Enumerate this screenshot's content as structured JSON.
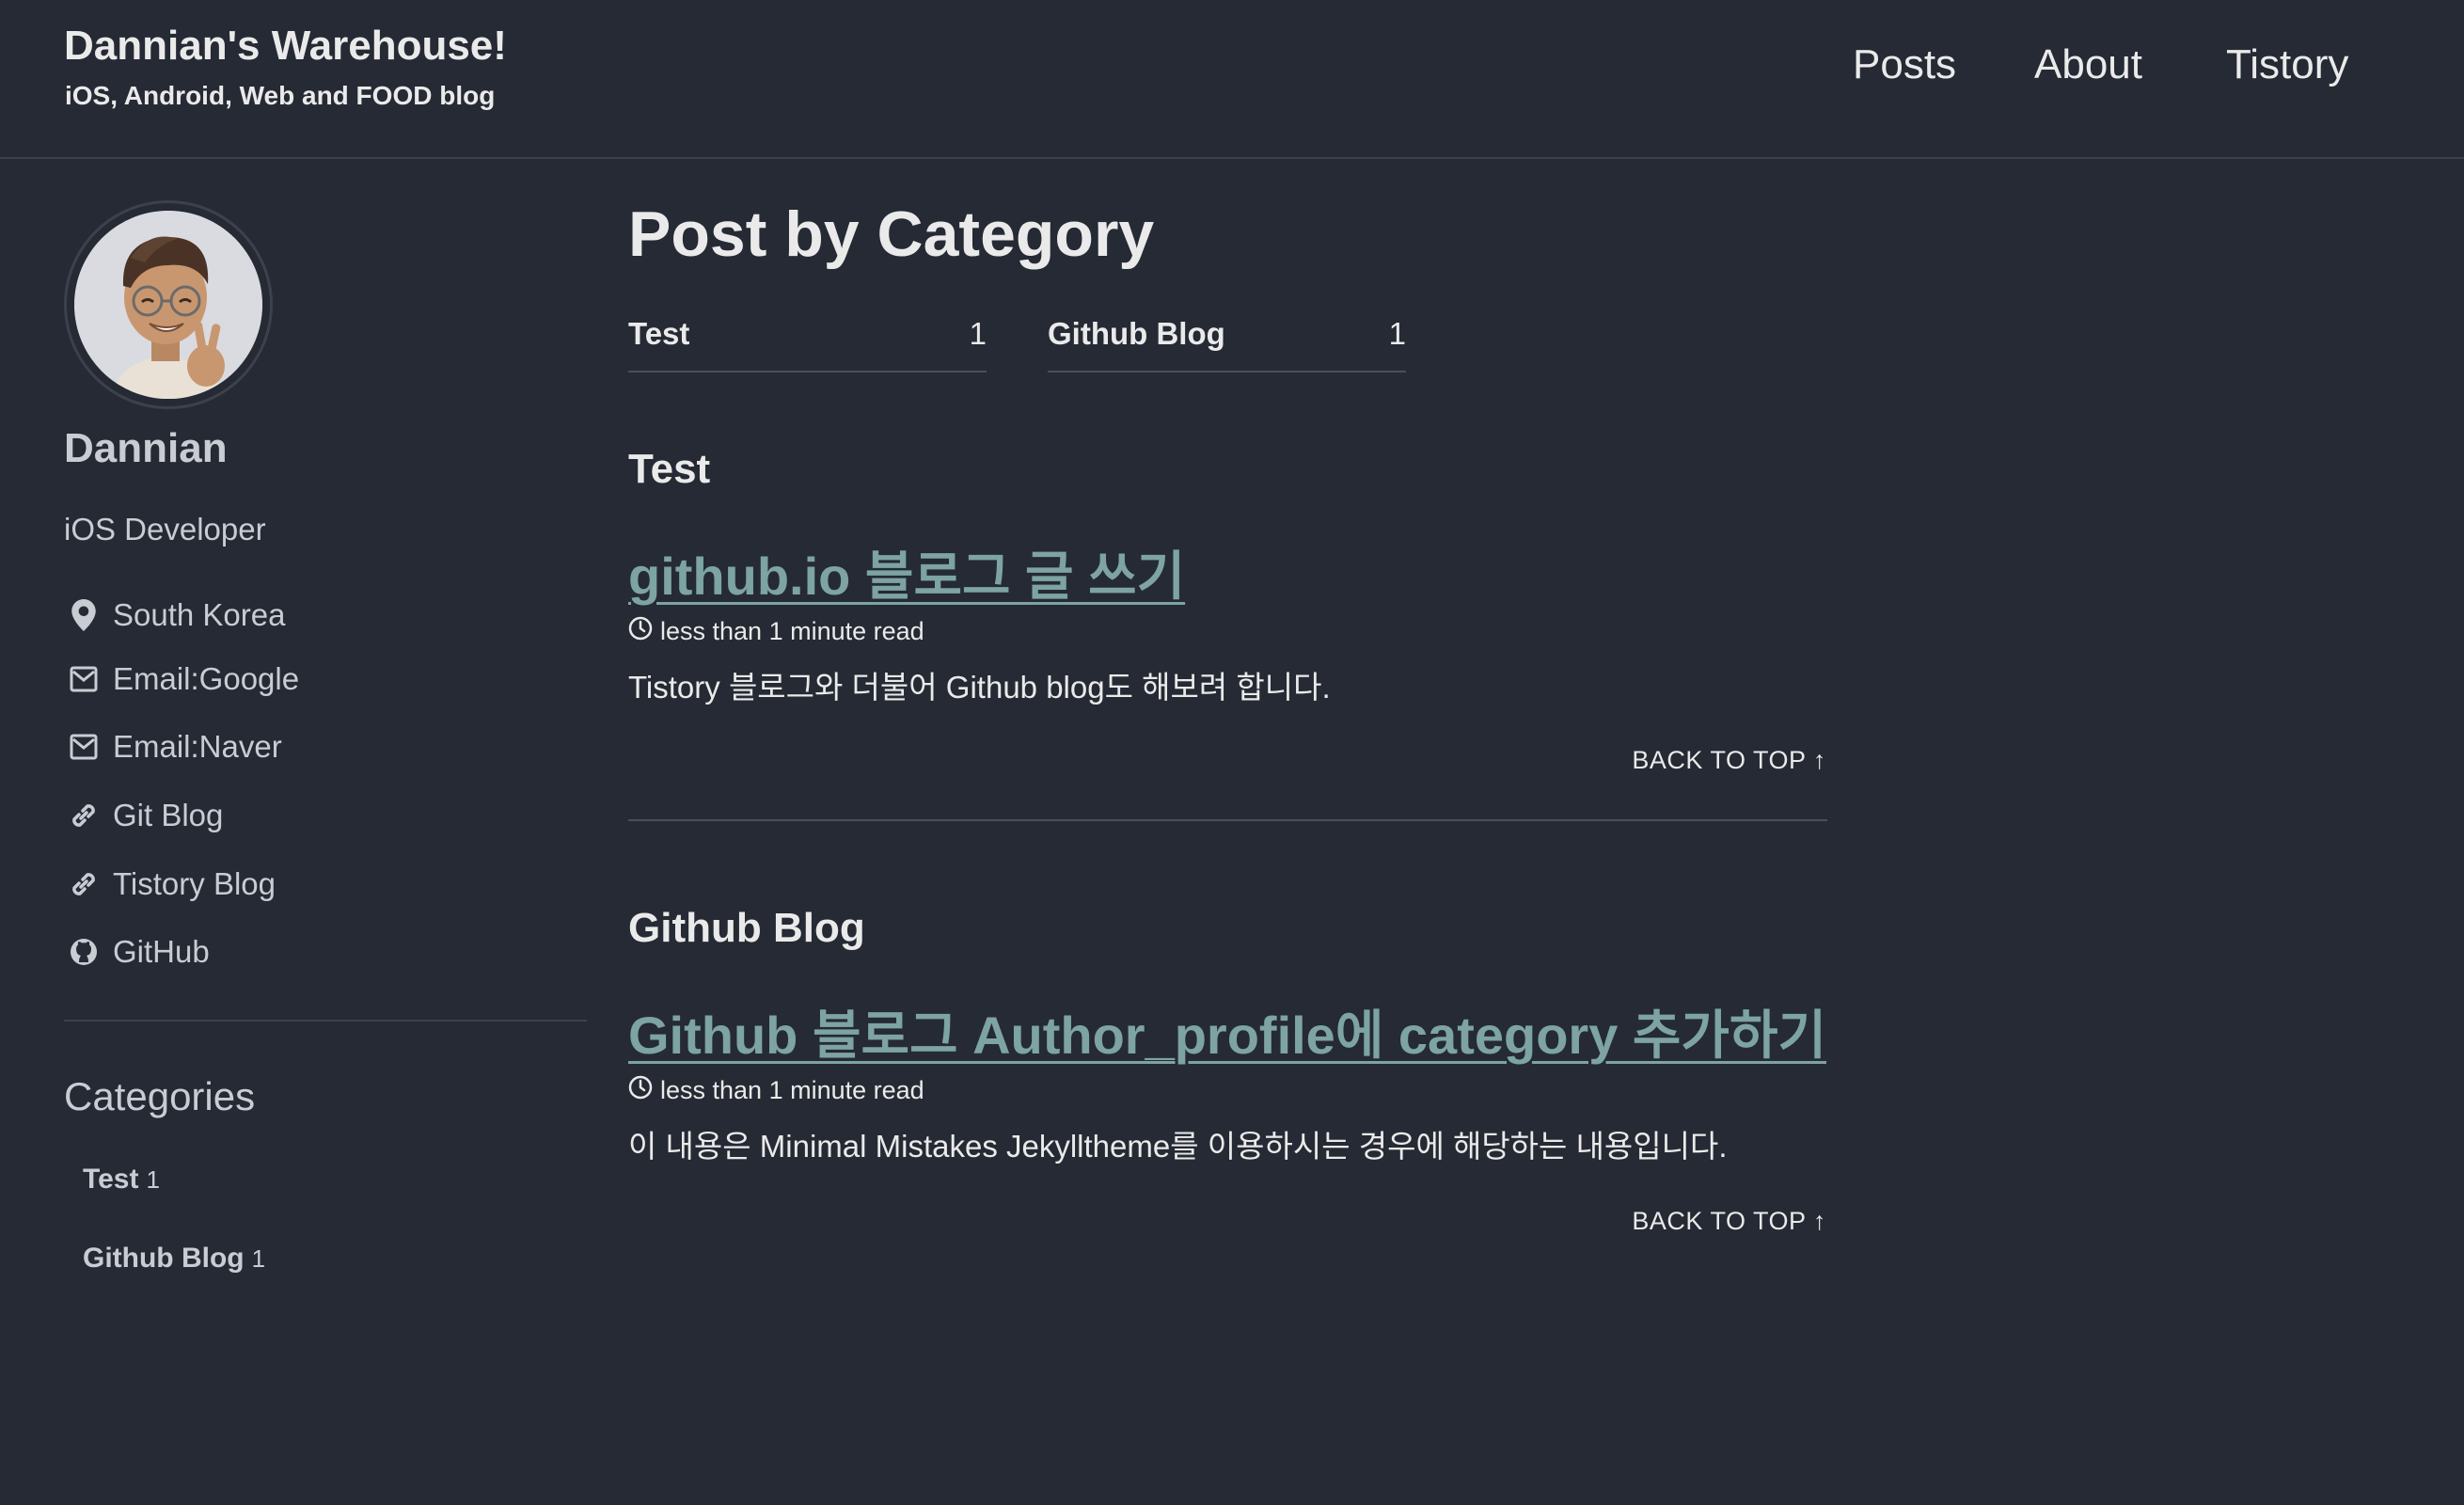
{
  "masthead": {
    "site_title": "Dannian's Warehouse!",
    "subtitle": "iOS, Android, Web and FOOD blog",
    "nav": [
      "Posts",
      "About",
      "Tistory"
    ]
  },
  "author": {
    "name": "Dannian",
    "bio": "iOS Developer",
    "links": [
      {
        "label": "South Korea",
        "icon": "location-pin-icon"
      },
      {
        "label": "Email:Google",
        "icon": "email-icon"
      },
      {
        "label": "Email:Naver",
        "icon": "email-icon"
      },
      {
        "label": "Git Blog",
        "icon": "link-icon"
      },
      {
        "label": "Tistory Blog",
        "icon": "link-icon"
      },
      {
        "label": "GitHub",
        "icon": "github-icon"
      }
    ]
  },
  "sidebar_categories": {
    "title": "Categories",
    "items": [
      {
        "name": "Test",
        "count": "1"
      },
      {
        "name": "Github Blog",
        "count": "1"
      }
    ]
  },
  "main": {
    "title": "Post by Category",
    "taxonomy": [
      {
        "name": "Test",
        "count": "1"
      },
      {
        "name": "Github Blog",
        "count": "1"
      }
    ],
    "sections": [
      {
        "title": "Test",
        "post_title": "github.io 블로그 글 쓰기",
        "read_time": "less than 1 minute read",
        "excerpt": "Tistory 블로그와 더불어 Github blog도 해보려 합니다.",
        "back_to_top": "BACK TO TOP ↑"
      },
      {
        "title": "Github Blog",
        "post_title": "Github 블로그 Author_profile에 category 추가하기",
        "read_time": "less than 1 minute read",
        "excerpt": "이 내용은 Minimal Mistakes Jekylltheme를 이용하시는 경우에 해당하는 내용입니다.",
        "back_to_top": "BACK TO TOP ↑"
      }
    ]
  },
  "colors": {
    "background": "#252a34",
    "link": "#7da3a3",
    "text": "#eaeaea",
    "muted_text": "#c9ccd2",
    "divider": "#3c414c"
  }
}
